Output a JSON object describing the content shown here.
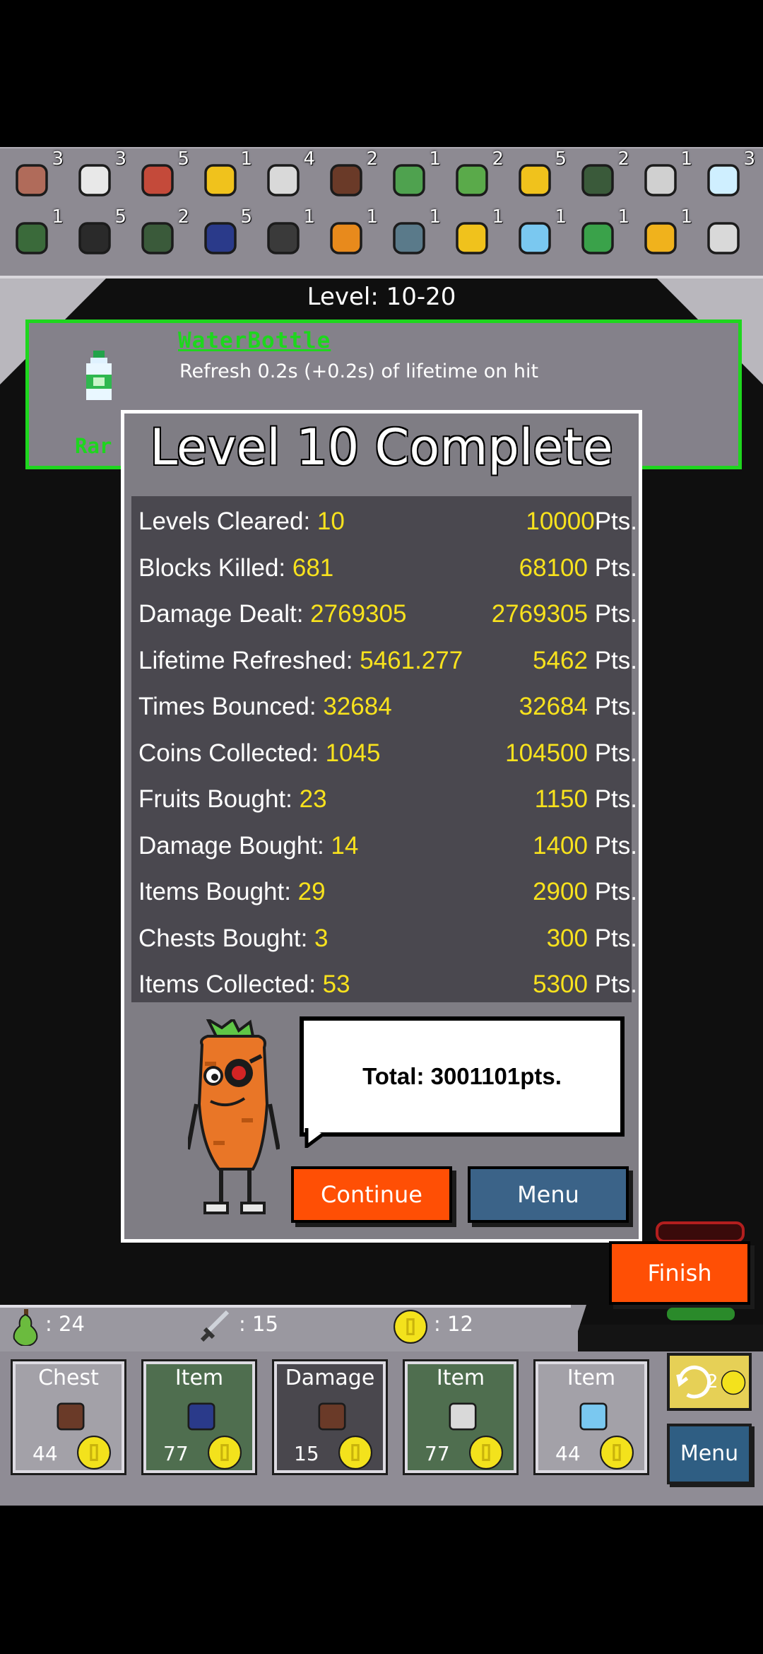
{
  "inventory": {
    "row1": [
      {
        "icon": "rod-icon",
        "count": "3"
      },
      {
        "icon": "jar-icon",
        "count": "3"
      },
      {
        "icon": "dagger-icon",
        "count": "5"
      },
      {
        "icon": "radioactive-apple-icon",
        "count": "1"
      },
      {
        "icon": "machete-icon",
        "count": "4"
      },
      {
        "icon": "wallet-icon",
        "count": "2"
      },
      {
        "icon": "slingshot-icon",
        "count": "1"
      },
      {
        "icon": "grenade-icon",
        "count": "2"
      },
      {
        "icon": "raygun-icon",
        "count": "5"
      },
      {
        "icon": "mace-icon",
        "count": "2"
      },
      {
        "icon": "blaster-icon",
        "count": "1"
      },
      {
        "icon": "water-bottle-icon",
        "count": "3"
      }
    ],
    "row2": [
      {
        "icon": "rifle-icon",
        "count": "1"
      },
      {
        "icon": "cauldron-icon",
        "count": "5"
      },
      {
        "icon": "rocket-icon",
        "count": "2"
      },
      {
        "icon": "goblet-icon",
        "count": "5"
      },
      {
        "icon": "ring-of-orbs-icon",
        "count": "1"
      },
      {
        "icon": "mushroom-icon",
        "count": "1"
      },
      {
        "icon": "tree-orb-icon",
        "count": "1"
      },
      {
        "icon": "horn-icon",
        "count": "1"
      },
      {
        "icon": "feather-icon",
        "count": "1"
      },
      {
        "icon": "plant-icon",
        "count": "1"
      },
      {
        "icon": "cannon-icon",
        "count": "1"
      },
      {
        "icon": "scythe-icon",
        "count": ""
      }
    ]
  },
  "level_label": "Level: 10-20",
  "tooltip": {
    "name": "WaterBottle",
    "description": "Refresh 0.2s (+0.2s) of lifetime on hit",
    "rarity": "Rar",
    "icon": "water-bottle-icon"
  },
  "dialog": {
    "title": "Level 10 Complete",
    "stats": [
      {
        "label": "Levels Cleared: ",
        "value": "10",
        "points": "10000",
        "unit": "Pts."
      },
      {
        "label": "Blocks Killed: ",
        "value": "681",
        "points": "68100",
        "unit": " Pts."
      },
      {
        "label": "Damage Dealt: ",
        "value": "2769305",
        "points": "2769305",
        "unit": " Pts."
      },
      {
        "label": "Lifetime Refreshed: ",
        "value": "5461.277",
        "points": "5462",
        "unit": " Pts."
      },
      {
        "label": "Times Bounced: ",
        "value": "32684",
        "points": "32684",
        "unit": " Pts."
      },
      {
        "label": "Coins Collected: ",
        "value": "1045",
        "points": "104500",
        "unit": " Pts."
      },
      {
        "label": "Fruits Bought: ",
        "value": "23",
        "points": "1150",
        "unit": " Pts."
      },
      {
        "label": "Damage Bought: ",
        "value": "14",
        "points": "1400",
        "unit": " Pts."
      },
      {
        "label": "Items Bought: ",
        "value": "29",
        "points": "2900",
        "unit": " Pts."
      },
      {
        "label": "Chests Bought: ",
        "value": "3",
        "points": "300",
        "unit": " Pts."
      },
      {
        "label": "Items Collected: ",
        "value": "53",
        "points": "5300",
        "unit": " Pts."
      }
    ],
    "total": "Total: 3001101pts.",
    "continue_label": "Continue",
    "menu_label": "Menu"
  },
  "finish_label": "Finish",
  "status_bar": {
    "fruit": ": 24",
    "damage": ": 15",
    "coins": ": 12"
  },
  "shop": {
    "cards": [
      {
        "title": "Chest",
        "price": "44",
        "icon": "chest-icon",
        "color": "#a3a1a8"
      },
      {
        "title": "Item",
        "price": "77",
        "icon": "goblet-icon",
        "color": "#4f6e4f"
      },
      {
        "title": "Damage",
        "price": "15",
        "icon": "sword-icon",
        "color": "#49474d"
      },
      {
        "title": "Item",
        "price": "77",
        "icon": "machete-icon",
        "color": "#4f6e4f"
      },
      {
        "title": "Item",
        "price": "44",
        "icon": "feather-icon",
        "color": "#a3a1a8"
      }
    ],
    "reroll_count": "2",
    "menu_label": "Menu"
  },
  "colors": {
    "accent_yellow": "#f8e21d",
    "rarity_green": "#1ed61e",
    "continue_orange": "#ff4f05",
    "menu_blue": "#3b6388"
  }
}
